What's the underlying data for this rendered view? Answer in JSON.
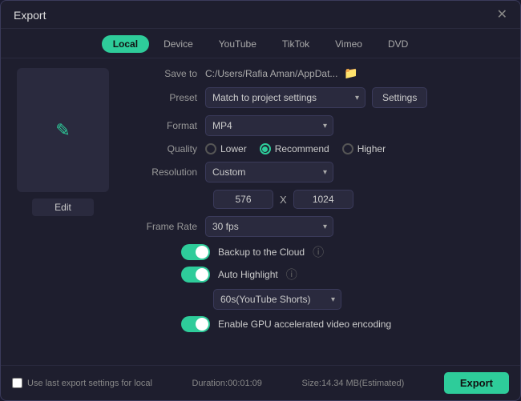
{
  "window": {
    "title": "Export",
    "close_label": "✕"
  },
  "tabs": [
    {
      "label": "Local",
      "active": true
    },
    {
      "label": "Device",
      "active": false
    },
    {
      "label": "YouTube",
      "active": false
    },
    {
      "label": "TikTok",
      "active": false
    },
    {
      "label": "Vimeo",
      "active": false
    },
    {
      "label": "DVD",
      "active": false
    }
  ],
  "preview": {
    "edit_label": "Edit"
  },
  "fields": {
    "save_to_label": "Save to",
    "save_path": "C:/Users/Rafia Aman/AppDat...",
    "preset_label": "Preset",
    "preset_value": "Match to project settings",
    "settings_label": "Settings",
    "format_label": "Format",
    "format_value": "MP4",
    "quality_label": "Quality",
    "quality_lower": "Lower",
    "quality_recommend": "Recommend",
    "quality_higher": "Higher",
    "resolution_label": "Resolution",
    "resolution_value": "Custom",
    "dim_width": "576",
    "dim_x": "X",
    "dim_height": "1024",
    "frame_rate_label": "Frame Rate",
    "frame_rate_value": "30 fps"
  },
  "toggles": {
    "backup_label": "Backup to the Cloud",
    "auto_highlight_label": "Auto Highlight",
    "youtube_shorts_value": "60s(YouTube Shorts)",
    "gpu_label": "Enable GPU accelerated video encoding"
  },
  "footer": {
    "use_last_label": "Use last export settings for local",
    "duration_label": "Duration:00:01:09",
    "size_label": "Size:14.34 MB(Estimated)",
    "export_label": "Export"
  }
}
